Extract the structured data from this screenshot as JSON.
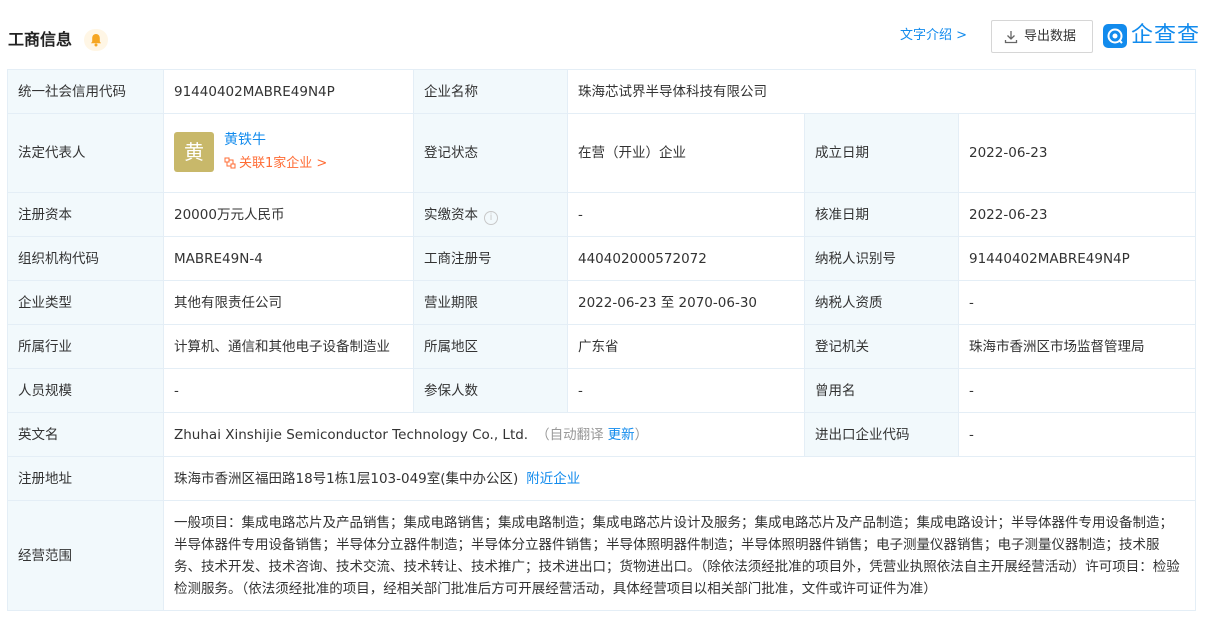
{
  "header": {
    "title": "工商信息",
    "text_intro": "文字介绍 >",
    "export_label": "导出数据",
    "logo_text": "企查查",
    "accent_color": "#128bed"
  },
  "rows": {
    "credit_code": {
      "label": "统一社会信用代码",
      "value": "91440402MABRE49N4P"
    },
    "company_name": {
      "label": "企业名称",
      "value": "珠海芯试界半导体科技有限公司"
    },
    "legal_rep": {
      "label": "法定代表人",
      "avatar_char": "黄",
      "name": "黄铁牛",
      "related": "关联1家企业 >"
    },
    "reg_status": {
      "label": "登记状态",
      "value": "在营（开业）企业"
    },
    "found_date": {
      "label": "成立日期",
      "value": "2022-06-23"
    },
    "reg_capital": {
      "label": "注册资本",
      "value": "20000万元人民币"
    },
    "paid_capital": {
      "label": "实缴资本",
      "value": "-"
    },
    "approve_date": {
      "label": "核准日期",
      "value": "2022-06-23"
    },
    "org_code": {
      "label": "组织机构代码",
      "value": "MABRE49N-4"
    },
    "reg_number": {
      "label": "工商注册号",
      "value": "440402000572072"
    },
    "taxpayer_id": {
      "label": "纳税人识别号",
      "value": "91440402MABRE49N4P"
    },
    "company_type": {
      "label": "企业类型",
      "value": "其他有限责任公司"
    },
    "business_term": {
      "label": "营业期限",
      "value": "2022-06-23 至 2070-06-30"
    },
    "taxpayer_qual": {
      "label": "纳税人资质",
      "value": "-"
    },
    "industry": {
      "label": "所属行业",
      "value": "计算机、通信和其他电子设备制造业"
    },
    "region": {
      "label": "所属地区",
      "value": "广东省"
    },
    "reg_authority": {
      "label": "登记机关",
      "value": "珠海市香洲区市场监督管理局"
    },
    "staff_size": {
      "label": "人员规模",
      "value": "-"
    },
    "insured": {
      "label": "参保人数",
      "value": "-"
    },
    "former_name": {
      "label": "曾用名",
      "value": "-"
    },
    "english_name": {
      "label": "英文名",
      "value": "Zhuhai Xinshijie Semiconductor Technology Co., Ltd.",
      "auto_open": "（自动翻译",
      "update": "更新",
      "auto_close": "）"
    },
    "import_export": {
      "label": "进出口企业代码",
      "value": "-"
    },
    "address": {
      "label": "注册地址",
      "value": "珠海市香洲区福田路18号1栋1层103-049室(集中办公区)",
      "nearby": "附近企业"
    },
    "scope": {
      "label": "经营范围",
      "value": "一般项目：集成电路芯片及产品销售；集成电路销售；集成电路制造；集成电路芯片设计及服务；集成电路芯片及产品制造；集成电路设计；半导体器件专用设备制造；半导体器件专用设备销售；半导体分立器件制造；半导体分立器件销售；半导体照明器件制造；半导体照明器件销售；电子测量仪器销售；电子测量仪器制造；技术服务、技术开发、技术咨询、技术交流、技术转让、技术推广；技术进出口；货物进出口。（除依法须经批准的项目外，凭营业执照依法自主开展经营活动）许可项目：检验检测服务。（依法须经批准的项目，经相关部门批准后方可开展经营活动，具体经营项目以相关部门批准，文件或许可证件为准）"
    }
  }
}
